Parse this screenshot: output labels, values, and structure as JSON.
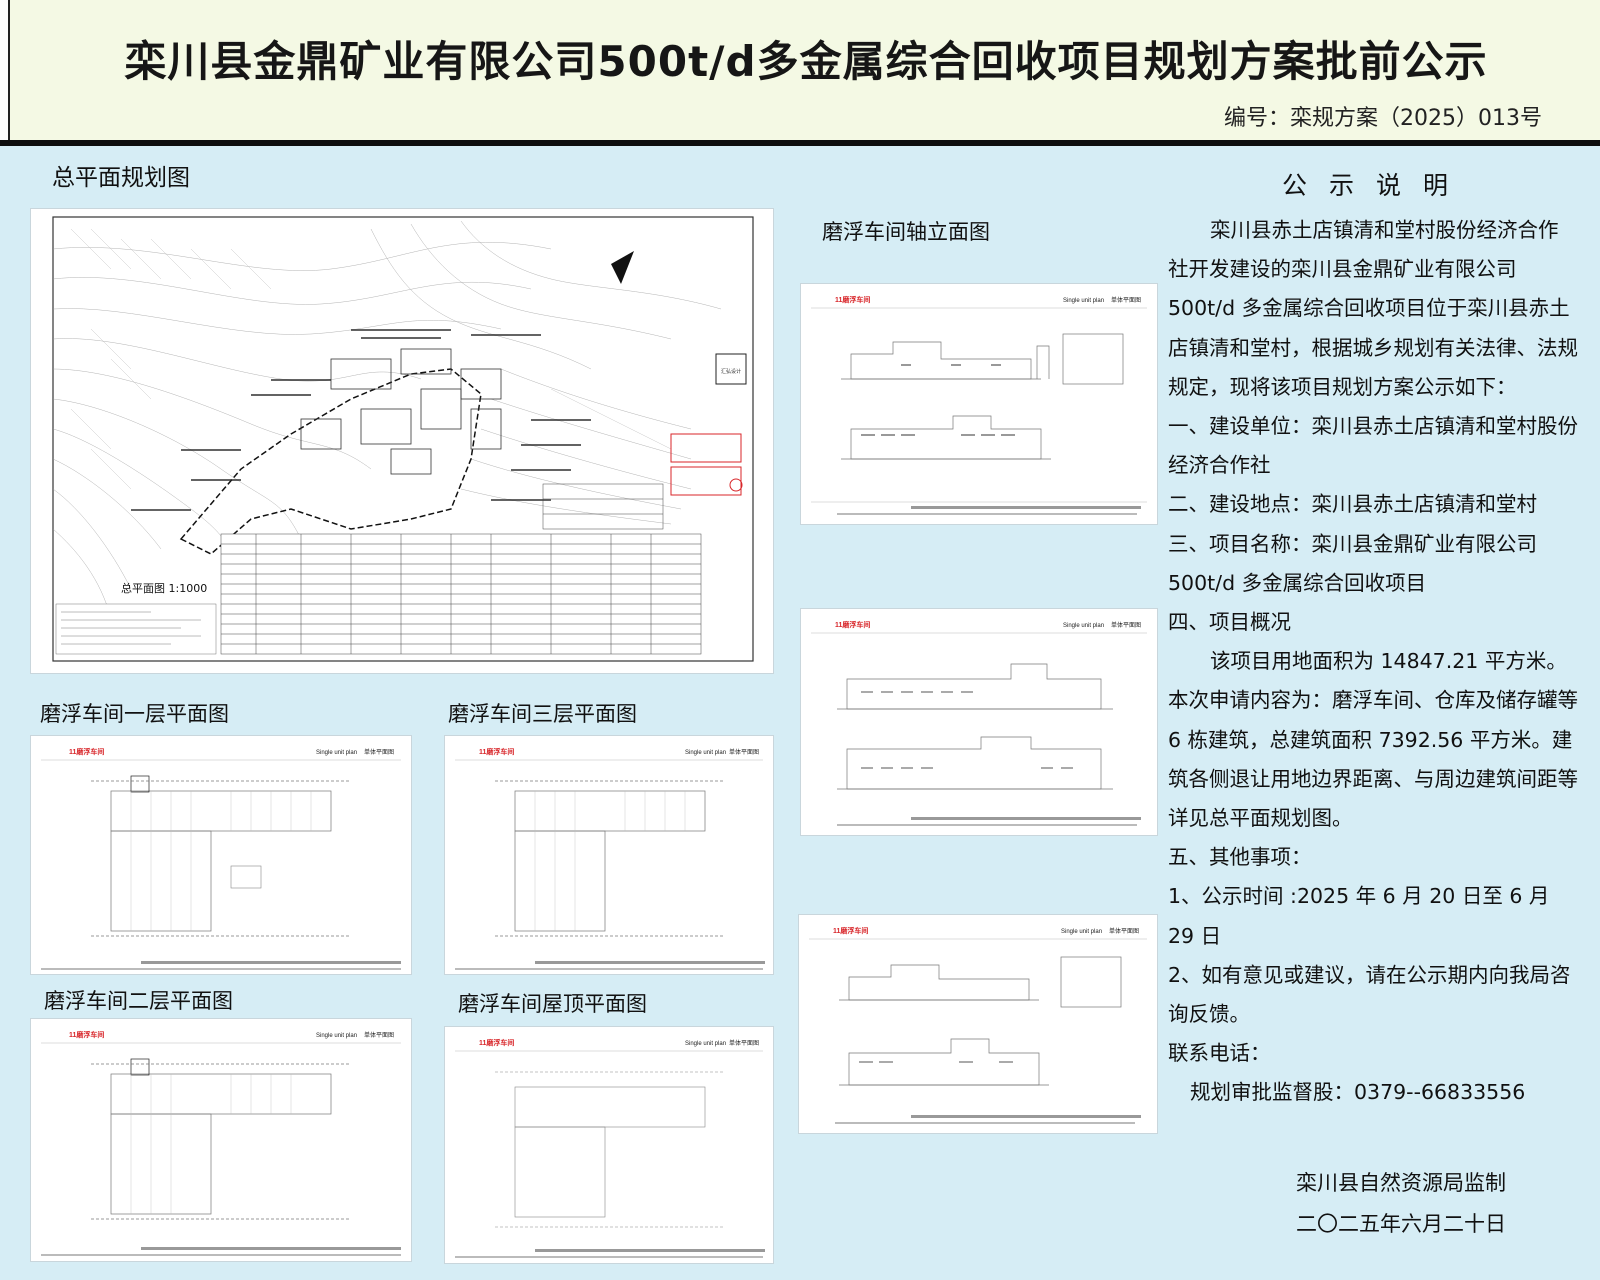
{
  "header": {
    "title": "栾川县金鼎矿业有限公司500t/d多金属综合回收项目规划方案批前公示",
    "code": "编号：栾规方案（2025）013号"
  },
  "sections": {
    "site_plan": "总平面规划图",
    "elevation": "磨浮车间轴立面图",
    "floor1": "磨浮车间一层平面图",
    "floor3": "磨浮车间三层平面图",
    "floor2": "磨浮车间二层平面图",
    "roof": "磨浮车间屋顶平面图"
  },
  "drawing": {
    "sheet_tag": "11磨浮车间",
    "sheet_right": "Single unit plan",
    "sheet_right_cn": "单体平面图",
    "site_plan_caption": "总平面图 1:1000"
  },
  "notice": {
    "title": "公示说明",
    "p1": "栾川县赤土店镇清和堂村股份经济合作社开发建设的栾川县金鼎矿业有限公司500t/d 多金属综合回收项目位于栾川县赤土店镇清和堂村，根据城乡规划有关法律、法规规定，现将该项目规划方案公示如下：",
    "p2": "一、建设单位：栾川县赤土店镇清和堂村股份经济合作社",
    "p3": "二、建设地点：栾川县赤土店镇清和堂村",
    "p4": "三、项目名称：栾川县金鼎矿业有限公司500t/d 多金属综合回收项目",
    "p5": "四、项目概况",
    "p6": "该项目用地面积为 14847.21 平方米。本次申请内容为：磨浮车间、仓库及储存罐等 6 栋建筑，总建筑面积 7392.56 平方米。建筑各侧退让用地边界距离、与周边建筑间距等详见总平面规划图。",
    "p7": "五、其他事项：",
    "p8": "1、公示时间 :2025 年 6 月 20 日至 6 月 29 日",
    "p9": "2、如有意见或建议，请在公示期内向我局咨询反馈。",
    "p10": "联系电话：",
    "p11": "规划审批监督股：0379--66833556"
  },
  "signature": {
    "agency": "栾川县自然资源局监制",
    "date": "二〇二五年六月二十日"
  },
  "colors": {
    "board": "#d6edf5",
    "header": "#f4f9e4",
    "accent_red": "#d8262a"
  }
}
